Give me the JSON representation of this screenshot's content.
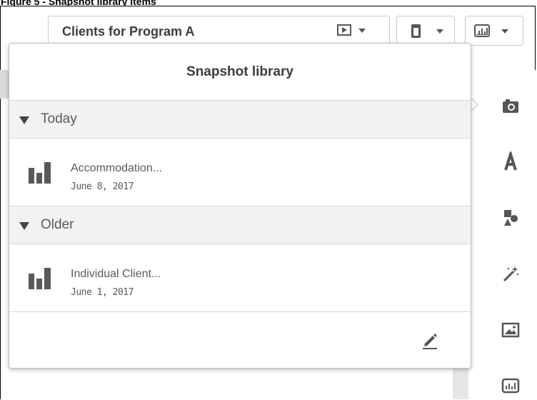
{
  "figure_caption": "Figure 5 - Snapshot library items",
  "toolbar": {
    "sheet_title": "Clients for Program A",
    "play_label": "play-icon",
    "device_label": "device-icon",
    "chart_label": "chart-icon"
  },
  "popover": {
    "title": "Snapshot library",
    "groups": [
      {
        "label": "Today",
        "items": [
          {
            "name": "Accommodation...",
            "date": "June 8, 2017"
          }
        ]
      },
      {
        "label": "Older",
        "items": [
          {
            "name": "Individual Client...",
            "date": "June 1, 2017"
          }
        ]
      }
    ],
    "edit_icon": "pencil-icon"
  },
  "sidebar_icons": [
    "camera-icon",
    "text-icon",
    "shapes-icon",
    "magic-wand-icon",
    "image-icon",
    "chart-icon"
  ],
  "colors": {
    "header_bg": "#f2f2f2",
    "text": "#595959",
    "icon": "#555555"
  }
}
